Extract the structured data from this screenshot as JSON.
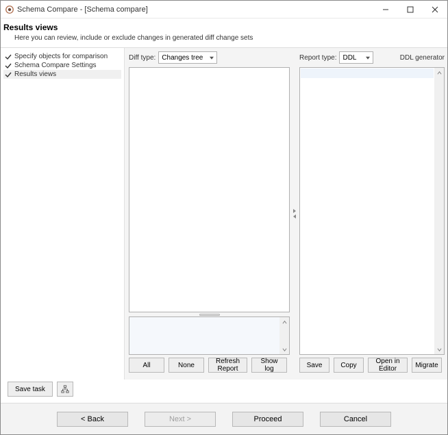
{
  "window": {
    "title": "Schema Compare - [Schema compare]"
  },
  "header": {
    "title": "Results views",
    "subtitle": "Here you can review, include or exclude changes in generated diff change sets"
  },
  "sidebar": {
    "steps": [
      {
        "label": "Specify objects for comparison",
        "done": true
      },
      {
        "label": "Schema Compare Settings",
        "done": true
      },
      {
        "label": "Results views",
        "done": true,
        "active": true
      }
    ]
  },
  "leftPane": {
    "diffTypeLabel": "Diff type:",
    "diffTypeValue": "Changes tree",
    "buttons": {
      "all": "All",
      "none": "None",
      "refresh": "Refresh Report",
      "showLog": "Show log"
    }
  },
  "rightPane": {
    "reportTypeLabel": "Report type:",
    "reportTypeValue": "DDL",
    "generatorLabel": "DDL generator",
    "buttons": {
      "save": "Save",
      "copy": "Copy",
      "open": "Open in Editor",
      "migrate": "Migrate"
    }
  },
  "taskBar": {
    "saveTask": "Save task"
  },
  "footer": {
    "back": "< Back",
    "next": "Next >",
    "proceed": "Proceed",
    "cancel": "Cancel"
  }
}
